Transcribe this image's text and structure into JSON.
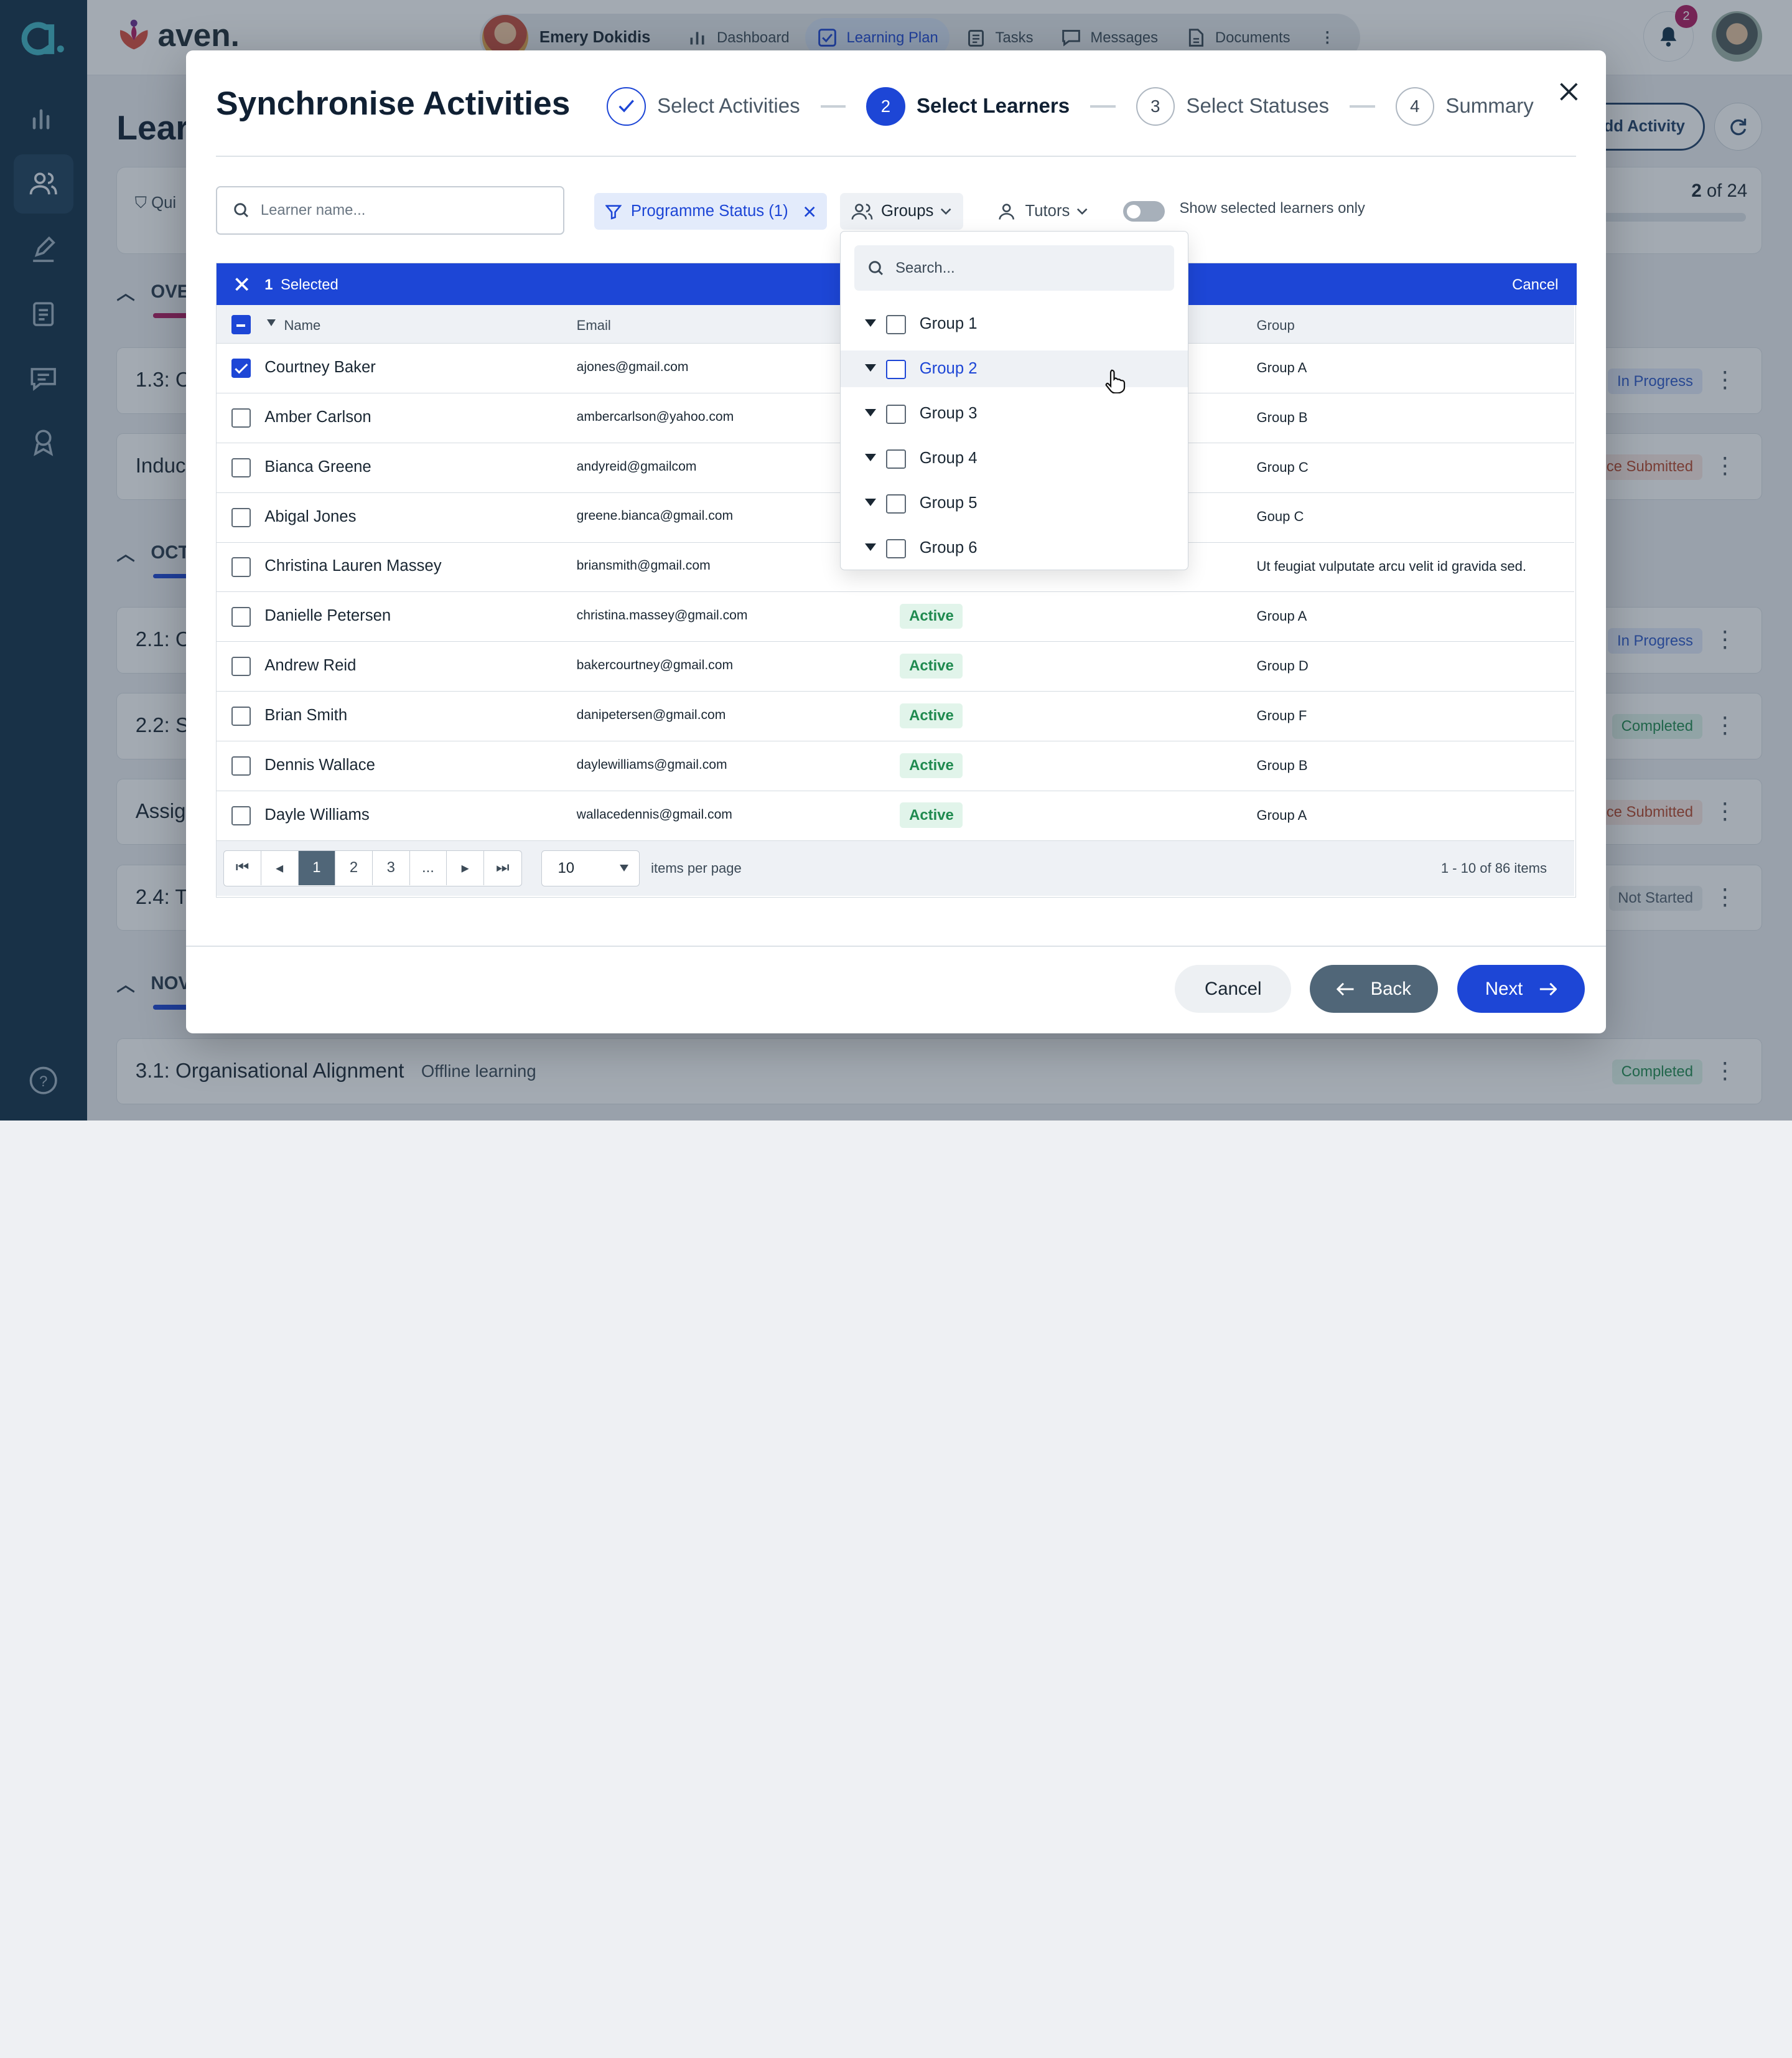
{
  "app": {
    "brand": "aven.",
    "logo_letter": "a."
  },
  "topnav": {
    "user_name": "Emery Dokidis",
    "tabs": [
      {
        "label": "Dashboard",
        "icon": "bar-chart-icon"
      },
      {
        "label": "Learning Plan",
        "icon": "checkbox-icon",
        "active": true
      },
      {
        "label": "Tasks",
        "icon": "clipboard-icon"
      },
      {
        "label": "Messages",
        "icon": "chat-icon"
      },
      {
        "label": "Documents",
        "icon": "document-icon"
      }
    ],
    "notifications": "2"
  },
  "background": {
    "page_title": "Learn",
    "add_activity": "Add Activity",
    "quick_filter": "Qui",
    "counter_current": "2",
    "counter_text": "of 24",
    "sections": [
      "OVE",
      "OCT",
      "NOV"
    ],
    "cards": [
      {
        "label": "1.3: O",
        "sub": "",
        "status": "In Progress"
      },
      {
        "label": "Induc",
        "sub": "",
        "status": "ce Submitted"
      },
      {
        "label": "2.1: O",
        "sub": "",
        "status": "In Progress"
      },
      {
        "label": "2.2: S",
        "sub": "",
        "status": "Completed"
      },
      {
        "label": "Assig",
        "sub": "",
        "status": "ce Submitted"
      },
      {
        "label": "2.4: T",
        "sub": "",
        "status": "Not Started"
      },
      {
        "label": "3.1: Organisational Alignment",
        "sub": "Offline learning",
        "status": "Completed"
      }
    ]
  },
  "modal": {
    "title": "Synchronise Activities",
    "steps": [
      {
        "num": "",
        "label": "Select Activities",
        "state": "done"
      },
      {
        "num": "2",
        "label": "Select Learners",
        "state": "active"
      },
      {
        "num": "3",
        "label": "Select Statuses",
        "state": "todo"
      },
      {
        "num": "4",
        "label": "Summary",
        "state": "todo"
      }
    ],
    "search_placeholder": "Learner name...",
    "filter_chip": "Programme Status (1)",
    "groups_label": "Groups",
    "tutors_label": "Tutors",
    "toggle_label": "Show selected learners only",
    "selection": {
      "count": "1",
      "text": "Selected",
      "cancel": "Cancel"
    },
    "columns": {
      "name": "Name",
      "email": "Email",
      "group": "Group"
    },
    "rows": [
      {
        "name": "Courtney Baker",
        "email": "ajones@gmail.com",
        "status": "",
        "group": "Group A",
        "checked": true
      },
      {
        "name": "Amber Carlson",
        "email": "ambercarlson@yahoo.com",
        "status": "",
        "group": "Group B"
      },
      {
        "name": "Bianca Greene",
        "email": "andyreid@gmailcom",
        "status": "",
        "group": "Group C"
      },
      {
        "name": "Abigal Jones",
        "email": "greene.bianca@gmail.com",
        "status": "",
        "group": "Goup C"
      },
      {
        "name": "Christina Lauren Massey",
        "email": "briansmith@gmail.com",
        "status": "",
        "group": "Ut feugiat vulputate arcu velit id gravida sed."
      },
      {
        "name": "Danielle Petersen",
        "email": "christina.massey@gmail.com",
        "status": "Active",
        "group": "Group A"
      },
      {
        "name": "Andrew Reid",
        "email": "bakercourtney@gmail.com",
        "status": "Active",
        "group": "Group D"
      },
      {
        "name": "Brian Smith",
        "email": "danipetersen@gmail.com",
        "status": "Active",
        "group": "Group F"
      },
      {
        "name": "Dennis Wallace",
        "email": "daylewilliams@gmail.com",
        "status": "Active",
        "group": "Group B"
      },
      {
        "name": "Dayle Williams",
        "email": "wallacedennis@gmail.com",
        "status": "Active",
        "group": "Group A"
      }
    ],
    "pagination": {
      "pages": [
        "1",
        "2",
        "3",
        "..."
      ],
      "current": "1",
      "page_size": "10",
      "per_page_label": "items per page",
      "range": "1 - 10 of 86 items"
    },
    "buttons": {
      "cancel": "Cancel",
      "back": "Back",
      "next": "Next"
    }
  },
  "groups_dropdown": {
    "search_placeholder": "Search...",
    "items": [
      "Group 1",
      "Group 2",
      "Group 3",
      "Group 4",
      "Group 5",
      "Group 6"
    ],
    "hovered": "Group 2"
  },
  "colors": {
    "primary": "#1d46d6",
    "sidebar": "#102f47",
    "accent": "#b0195f",
    "active_green": "#1f8a4f"
  }
}
